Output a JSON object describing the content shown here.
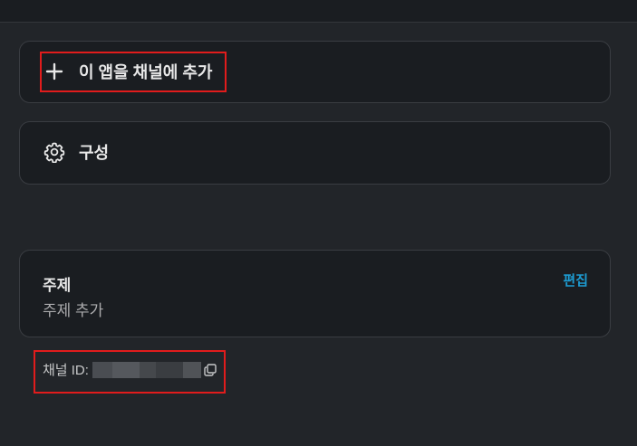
{
  "add_app": {
    "icon": "plus-icon",
    "label": "이 앱을 채널에 추가"
  },
  "config": {
    "icon": "gear-icon",
    "label": "구성"
  },
  "topic": {
    "title": "주제",
    "placeholder": "주제 추가",
    "edit_label": "편집"
  },
  "channel": {
    "id_label": "채널 ID:",
    "id_value_redacted": true,
    "copy_icon": "copy-icon"
  },
  "colors": {
    "background": "#222529",
    "card": "#1a1d21",
    "accent_link": "#1d9bd1",
    "highlight": "#e11c1c"
  }
}
